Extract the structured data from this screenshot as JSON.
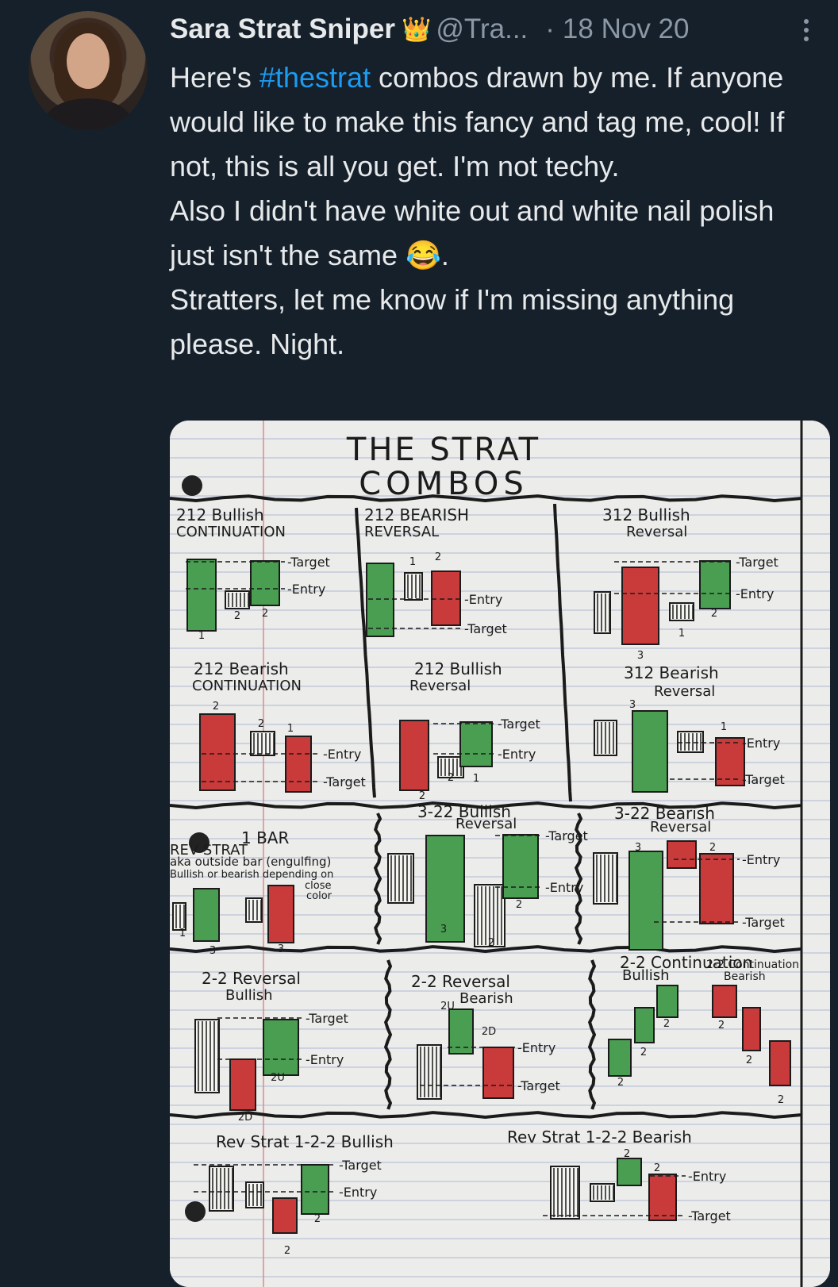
{
  "tweet": {
    "author_name": "Sara Strat Sniper",
    "badge_emoji": "👑",
    "handle": "@Tra...",
    "separator": "·",
    "date": "18 Nov 20",
    "hashtag": "#thestrat",
    "text_line1_before": "Here's ",
    "text_line1_after": " combos drawn by me. If anyone would like to make this fancy and tag me, cool! If not, this is all you get. I'm not techy.",
    "text_line2_before": "Also I didn't have white out and white nail polish just isn't the same ",
    "text_line2_emoji": "😂",
    "text_line2_after": ".",
    "text_line3": "Stratters, let me know if I'm missing anything please. Night."
  },
  "colors": {
    "background": "#15202b",
    "text": "#e7e9ea",
    "muted": "#8b98a5",
    "link": "#1d9bf0",
    "paper": "#ececea",
    "ink": "#1b1b1b",
    "candle_green": "#4a9e52",
    "candle_red": "#c93a3a"
  },
  "sheet": {
    "title_line1": "THE STRAT",
    "title_line2": "COMBOS",
    "panels": [
      {
        "title": "212 Bullish",
        "subtitle": "CONTINUATION",
        "labels": [
          "Target",
          "Entry"
        ],
        "numbers": [
          "1",
          "2",
          "2"
        ]
      },
      {
        "title": "212 BEARISH",
        "subtitle": "REVERSAL",
        "labels": [
          "Entry",
          "Target"
        ],
        "numbers": [
          "1",
          "2"
        ]
      },
      {
        "title": "312 Bullish",
        "subtitle": "Reversal",
        "labels": [
          "Target",
          "Entry"
        ],
        "numbers": [
          "3",
          "1",
          "2"
        ]
      },
      {
        "title": "212 Bearish",
        "subtitle": "CONTINUATION",
        "labels": [
          "Entry",
          "Target"
        ],
        "numbers": [
          "2",
          "1",
          "2"
        ]
      },
      {
        "title": "212 Bullish",
        "subtitle": "Reversal",
        "labels": [
          "Target",
          "Entry"
        ],
        "numbers": [
          "2",
          "1",
          "2"
        ]
      },
      {
        "title": "312 Bearish",
        "subtitle": "Reversal",
        "labels": [
          "Entry",
          "Target"
        ],
        "numbers": [
          "3",
          "1",
          "2"
        ]
      },
      {
        "title": "1 BAR",
        "subtitle": "REV STRAT",
        "note1": "aka outside bar (engulfing)",
        "note2": "Bullish or bearish depending on",
        "note3": "close",
        "note4": "color",
        "numbers": [
          "1",
          "3",
          "3"
        ]
      },
      {
        "title": "3-22 Bullish",
        "subtitle": "Reversal",
        "labels": [
          "Target",
          "Entry"
        ],
        "numbers": [
          "3",
          "2",
          "2"
        ]
      },
      {
        "title": "3-22 Bearish",
        "subtitle": "Reversal",
        "labels": [
          "Entry",
          "Target"
        ],
        "numbers": [
          "3",
          "2"
        ]
      },
      {
        "title": "2-2 Reversal",
        "subtitle": "Bullish",
        "labels": [
          "Target",
          "Entry"
        ],
        "numbers": [
          "2D",
          "2U"
        ]
      },
      {
        "title": "2-2 Reversal",
        "subtitle": "Bearish",
        "labels": [
          "Entry",
          "Target"
        ],
        "numbers": [
          "2U",
          "2D"
        ]
      },
      {
        "title": "2-2 Continuation",
        "subtitle": "Bullish",
        "title_b": "2-2 Continuation",
        "subtitle_b": "Bearish",
        "numbers": [
          "2",
          "2",
          "2",
          "2",
          "2",
          "2"
        ]
      },
      {
        "title": "Rev Strat 1-2-2 Bullish",
        "labels": [
          "Target",
          "Entry"
        ],
        "numbers": [
          "2",
          "2"
        ]
      },
      {
        "title": "Rev Strat 1-2-2 Bearish",
        "labels": [
          "Entry",
          "Target"
        ],
        "numbers": [
          "2",
          "2"
        ]
      }
    ]
  }
}
